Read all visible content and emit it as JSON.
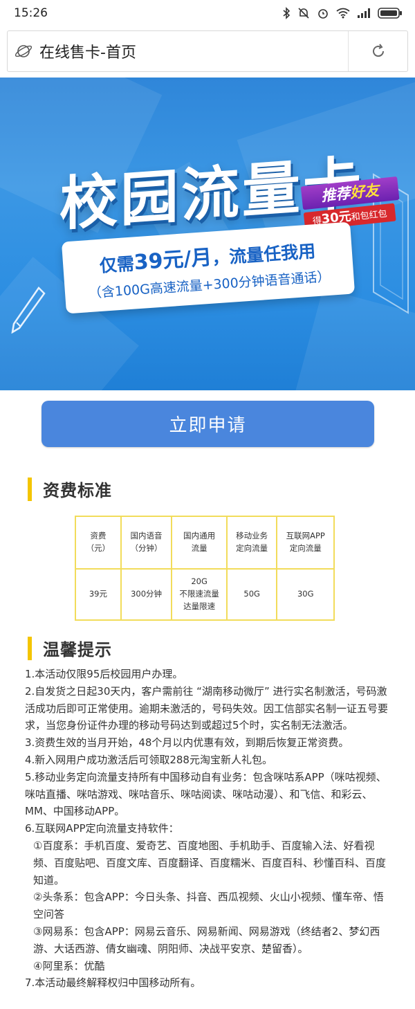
{
  "status_bar": {
    "time": "15:26"
  },
  "browser": {
    "page_title": "在线售卡-首页"
  },
  "banner": {
    "title": "校园流量卡",
    "price_prefix": "仅需",
    "price_value": "39元/月",
    "price_suffix": "，流量任我用",
    "subtitle": "（含100G高速流量+300分钟语音通话）",
    "badge_main_a": "推荐",
    "badge_main_b": "好友",
    "badge_sub_a": "得",
    "badge_sub_amount": "30元",
    "badge_sub_b": "和包红包"
  },
  "apply_button": {
    "label": "立即申请"
  },
  "fee_section": {
    "heading": "资费标准",
    "headers": [
      [
        "资费",
        "（元）"
      ],
      [
        "国内语音",
        "（分钟）"
      ],
      [
        "国内通用",
        "流量"
      ],
      [
        "移动业务",
        "定向流量"
      ],
      [
        "互联网APP",
        "定向流量"
      ]
    ],
    "row": [
      [
        "39元"
      ],
      [
        "300分钟"
      ],
      [
        "20G",
        "不限速流量",
        "达量限速"
      ],
      [
        "50G"
      ],
      [
        "30G"
      ]
    ]
  },
  "tips_section": {
    "heading": "温馨提示",
    "items": [
      "1.本活动仅限95后校园用户办理。",
      "2.自发货之日起30天内，客户需前往 “湖南移动微厅” 进行实名制激活，号码激活成功后即可正常使用。逾期未激活的，号码失效。因工信部实名制一证五号要求，当您身份证件办理的移动号码达到或超过5个时，实名制无法激活。",
      "3.资费生效的当月开始，48个月以内优惠有效，到期后恢复正常资费。",
      "4.新入网用户成功激活后可领取288元淘宝新人礼包。",
      "5.移动业务定向流量支持所有中国移动自有业务：包含咪咕系APP（咪咕视频、咪咕直播、咪咕游戏、咪咕音乐、咪咕阅读、咪咕动漫）、和飞信、和彩云、MM、中国移动APP。",
      "6.互联网APP定向流量支持软件：",
      "①百度系：手机百度、爱奇艺、百度地图、手机助手、百度输入法、好看视频、百度贴吧、百度文库、百度翻译、百度糯米、百度百科、秒懂百科、百度知道。",
      "②头条系：包含APP：今日头条、抖音、西瓜视频、火山小视频、懂车帝、悟空问答",
      "③网易系：包含APP：网易云音乐、网易新闻、网易游戏（终结者2、梦幻西游、大话西游、倩女幽魂、阴阳师、决战平安京、楚留香）。",
      "④阿里系：优酷",
      "7.本活动最终解释权归中国移动所有。"
    ]
  }
}
